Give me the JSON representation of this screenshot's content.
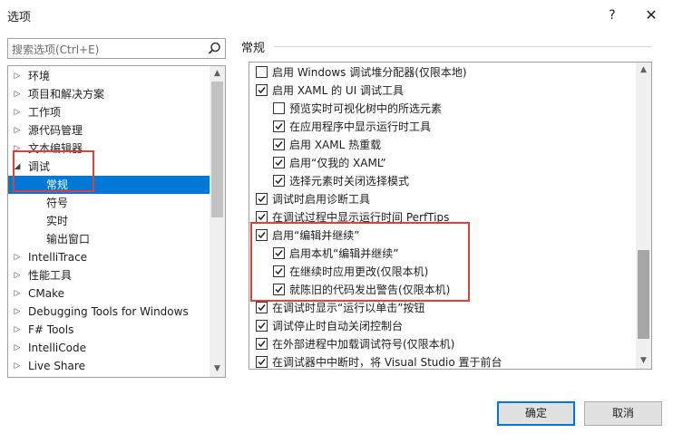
{
  "window": {
    "title": "选项",
    "help": "?",
    "close": "✕"
  },
  "search": {
    "placeholder": "搜索选项(Ctrl+E)"
  },
  "tree": {
    "items": [
      {
        "label": "环境",
        "arrow": "▷"
      },
      {
        "label": "项目和解决方案",
        "arrow": "▷"
      },
      {
        "label": "工作项",
        "arrow": "▷"
      },
      {
        "label": "源代码管理",
        "arrow": "▷"
      },
      {
        "label": "文本编辑器",
        "arrow": "▷"
      },
      {
        "label": "调试",
        "arrow": "◢"
      },
      {
        "label": "常规",
        "arrow": ""
      },
      {
        "label": "符号",
        "arrow": ""
      },
      {
        "label": "实时",
        "arrow": ""
      },
      {
        "label": "输出窗口",
        "arrow": ""
      },
      {
        "label": "IntelliTrace",
        "arrow": "▷"
      },
      {
        "label": "性能工具",
        "arrow": "▷"
      },
      {
        "label": "CMake",
        "arrow": "▷"
      },
      {
        "label": "Debugging Tools for Windows",
        "arrow": "▷"
      },
      {
        "label": "F# Tools",
        "arrow": "▷"
      },
      {
        "label": "IntelliCode",
        "arrow": "▷"
      },
      {
        "label": "Live Share",
        "arrow": "▷"
      }
    ],
    "selected_label": "常规"
  },
  "section": {
    "title": "常规"
  },
  "options": [
    {
      "label": "启用 Windows 调试堆分配器(仅限本地)",
      "checked": false
    },
    {
      "label": "启用 XAML 的 UI 调试工具",
      "checked": true
    },
    {
      "label": "预览实时可视化树中的所选元素",
      "checked": false
    },
    {
      "label": "在应用程序中显示运行时工具",
      "checked": true
    },
    {
      "label": "启用 XAML 热重载",
      "checked": true
    },
    {
      "label": "启用“仅我的 XAML”",
      "checked": true
    },
    {
      "label": "选择元素时关闭选择模式",
      "checked": true
    },
    {
      "label": "调试时启用诊断工具",
      "checked": true
    },
    {
      "label": "在调试过程中显示运行时间 PerfTips",
      "checked": true
    },
    {
      "label": "启用“编辑并继续”",
      "checked": true
    },
    {
      "label": "启用本机“编辑并继续”",
      "checked": true
    },
    {
      "label": "在继续时应用更改(仅限本机)",
      "checked": true
    },
    {
      "label": "就陈旧的代码发出警告(仅限本机)",
      "checked": true
    },
    {
      "label": "在调试时显示“运行以单击”按钮",
      "checked": true
    },
    {
      "label": "调试停止时自动关闭控制台",
      "checked": true
    },
    {
      "label": "在外部进程中加载调试符号(仅限本机)",
      "checked": true
    },
    {
      "label": "在调试器中中断时，将 Visual Studio 置于前台",
      "checked": true
    }
  ],
  "buttons": {
    "ok": "确定",
    "cancel": "取消"
  },
  "colors": {
    "selection": "#0078d7",
    "highlight_box": "#e0403a"
  }
}
